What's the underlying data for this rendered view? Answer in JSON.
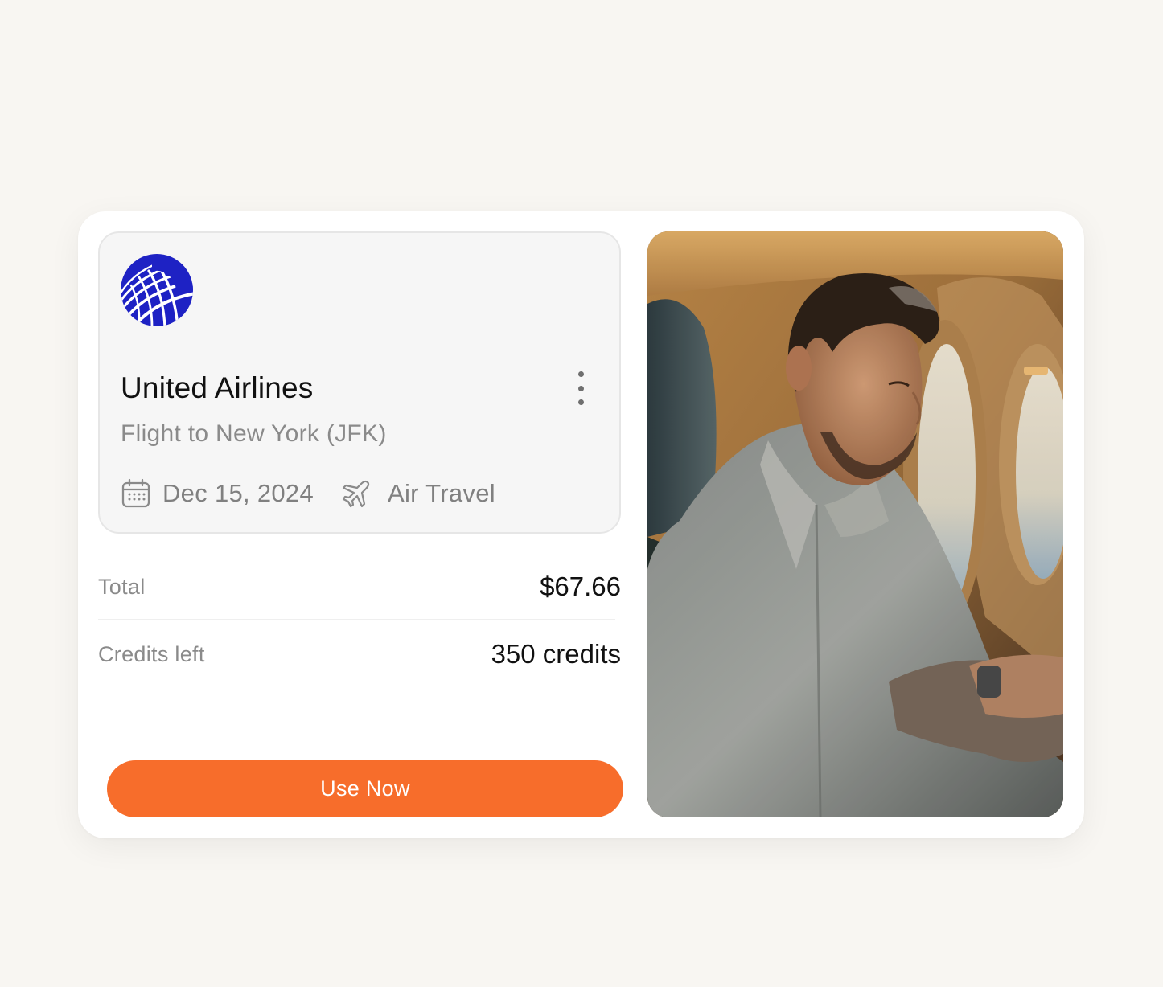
{
  "offer": {
    "airline_name": "United Airlines",
    "route": "Flight to New York (JFK)",
    "date": "Dec 15, 2024",
    "category": "Air Travel",
    "logo_icon": "united-globe-logo",
    "menu_icon": "more-vertical-icon",
    "date_icon": "calendar-icon",
    "category_icon": "airplane-icon"
  },
  "summary": {
    "total_label": "Total",
    "total_value": "$67.66",
    "credits_label": "Credits left",
    "credits_value": "350 credits"
  },
  "cta": {
    "label": "Use Now"
  },
  "photo": {
    "subject": "man-using-laptop-on-airplane"
  },
  "colors": {
    "page_background": "#f8f6f2",
    "card_background": "#ffffff",
    "ticket_background": "#f6f6f6",
    "accent": "#f76d2b",
    "logo_blue": "#1e22c4",
    "primary_text": "#111111",
    "secondary_text": "#8a8a8a"
  }
}
